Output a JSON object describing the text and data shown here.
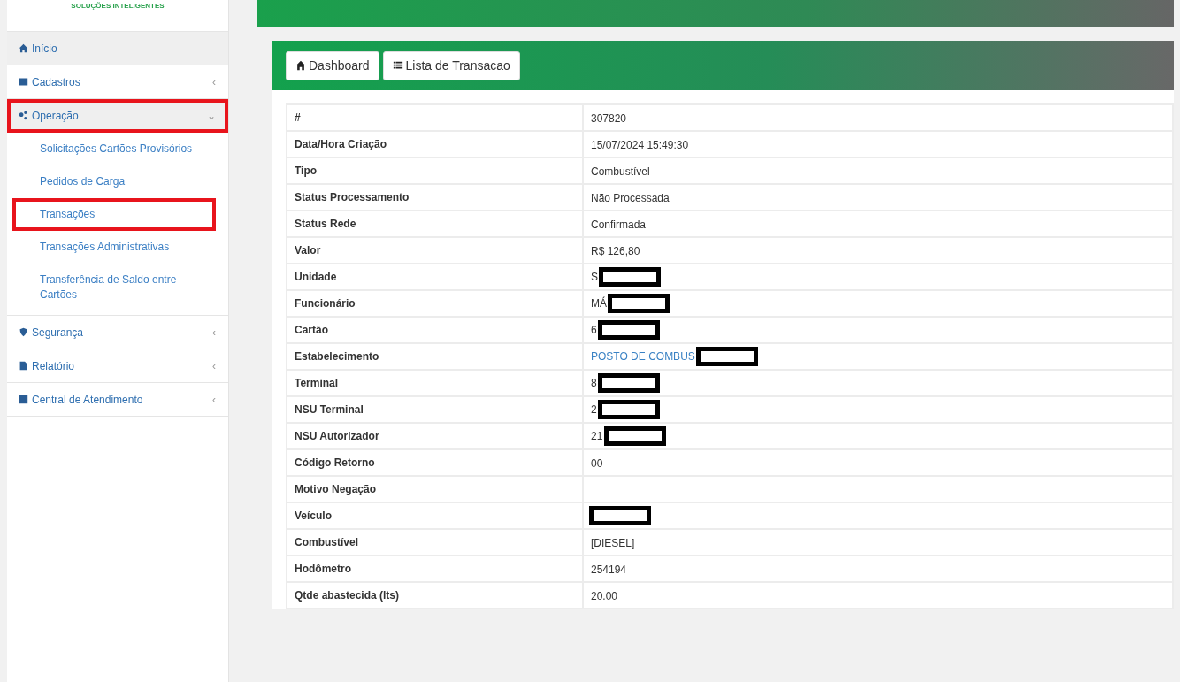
{
  "sidebar": {
    "tagline": "SOLUÇÕES INTELIGENTES",
    "items": [
      {
        "label": "Início",
        "selected": true,
        "highlighted": false
      },
      {
        "label": "Cadastros",
        "selected": false,
        "highlighted": false,
        "caret": "‹"
      },
      {
        "label": "Operação",
        "selected": true,
        "expanded": true,
        "highlighted": true,
        "caret": "⌄",
        "children": [
          {
            "label": "Solicitações Cartões Provisórios",
            "highlighted": false
          },
          {
            "label": "Pedidos de Carga",
            "highlighted": false
          },
          {
            "label": "Transações",
            "highlighted": true
          },
          {
            "label": "Transações Administrativas",
            "highlighted": false
          },
          {
            "label": "Transferência de Saldo entre Cartões",
            "highlighted": false
          }
        ]
      },
      {
        "label": "Segurança",
        "selected": false,
        "highlighted": false,
        "caret": "‹"
      },
      {
        "label": "Relatório",
        "selected": false,
        "highlighted": false,
        "caret": "‹"
      },
      {
        "label": "Central de Atendimento",
        "selected": false,
        "highlighted": false,
        "caret": "‹"
      }
    ]
  },
  "toolbar": {
    "buttons": [
      {
        "label": "Dashboard"
      },
      {
        "label": "Lista de Transacao"
      }
    ]
  },
  "details": {
    "rows": [
      {
        "label": "#",
        "value": "307820",
        "redacted": false,
        "link": false
      },
      {
        "label": "Data/Hora Criação",
        "value": "15/07/2024 15:49:30",
        "redacted": false,
        "link": false
      },
      {
        "label": "Tipo",
        "value": "Combustível",
        "redacted": false,
        "link": false
      },
      {
        "label": "Status Processamento",
        "value": "Não Processada",
        "redacted": false,
        "link": false
      },
      {
        "label": "Status Rede",
        "value": "Confirmada",
        "redacted": false,
        "link": false
      },
      {
        "label": "Valor",
        "value": "R$  126,80",
        "redacted": false,
        "link": false
      },
      {
        "label": "Unidade",
        "value": "S",
        "redacted": true,
        "link": false
      },
      {
        "label": "Funcionário",
        "value": "MÁ",
        "redacted": true,
        "link": false
      },
      {
        "label": "Cartão",
        "value": "6",
        "redacted": true,
        "link": false
      },
      {
        "label": "Estabelecimento",
        "value": "POSTO DE COMBUS",
        "redacted": true,
        "link": true
      },
      {
        "label": "Terminal",
        "value": "8",
        "redacted": true,
        "link": false
      },
      {
        "label": "NSU Terminal",
        "value": "2",
        "redacted": true,
        "link": false
      },
      {
        "label": "NSU Autorizador",
        "value": "21",
        "redacted": true,
        "link": false
      },
      {
        "label": "Código Retorno",
        "value": "00",
        "redacted": false,
        "link": false
      },
      {
        "label": "Motivo Negação",
        "redacted": false
      },
      {
        "label": "Veículo",
        "redacted": true
      },
      {
        "label": "Combustível",
        "value": "[DIESEL]",
        "redacted": false,
        "link": false
      },
      {
        "label": "Hodômetro",
        "value": "254194",
        "redacted": false,
        "link": false
      },
      {
        "label": "Qtde abastecida (lts)",
        "value": "20.00",
        "redacted": false,
        "link": false
      }
    ]
  }
}
